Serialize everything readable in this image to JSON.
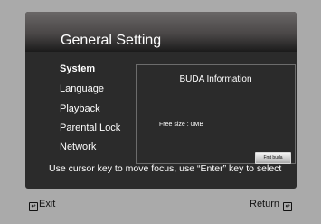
{
  "header": {
    "title": "General Setting"
  },
  "menu": {
    "items": [
      {
        "label": "System",
        "active": true
      },
      {
        "label": "Language",
        "active": false
      },
      {
        "label": "Playback",
        "active": false
      },
      {
        "label": "Parental Lock",
        "active": false
      },
      {
        "label": "Network",
        "active": false
      }
    ]
  },
  "panel": {
    "title": "BUDA Information",
    "free_size": "Free size : 0MB",
    "format_button": "Fmt buda"
  },
  "hint": "Use cursor key to move focus, use “Enter” key to select",
  "footer": {
    "exit_label": "Exit",
    "return_label": "Return"
  },
  "colors": {
    "background": "#aaaaaa",
    "frame": "#2b2b2b",
    "text": "#ffffff"
  }
}
